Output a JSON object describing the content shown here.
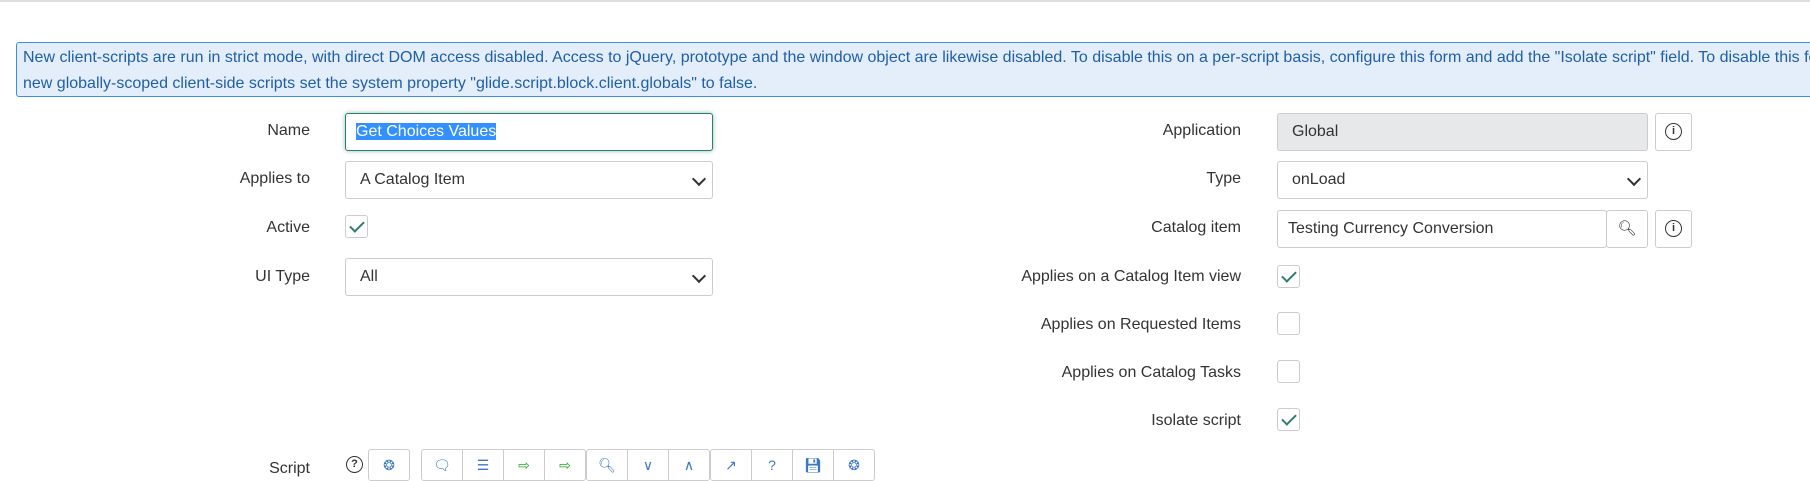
{
  "banner": "New client-scripts are run in strict mode, with direct DOM access disabled. Access to jQuery, prototype and the window object are likewise disabled. To disable this on a per-script basis, configure this form and add the \"Isolate script\" field. To disable this feature",
  "banner2": "new globally-scoped client-side scripts set the system property \"glide.script.block.client.globals\" to false.",
  "left": {
    "name_label": "Name",
    "name_value": "Get Choices Values",
    "applies_label": "Applies to",
    "applies_value": "A Catalog Item",
    "active_label": "Active",
    "active_checked": true,
    "uitype_label": "UI Type",
    "uitype_value": "All"
  },
  "right": {
    "application_label": "Application",
    "application_value": "Global",
    "type_label": "Type",
    "type_value": "onLoad",
    "catalog_label": "Catalog item",
    "catalog_value": "Testing Currency Conversion",
    "view_label": "Applies on a Catalog Item view",
    "view_checked": true,
    "req_label": "Applies on Requested Items",
    "req_checked": false,
    "tasks_label": "Applies on Catalog Tasks",
    "tasks_checked": false,
    "isolate_label": "Isolate script",
    "isolate_checked": true
  },
  "script": {
    "label": "Script",
    "help_icon": "?"
  }
}
